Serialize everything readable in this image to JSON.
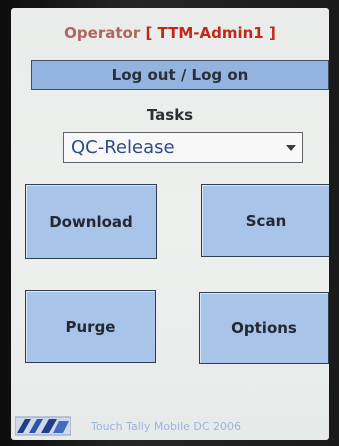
{
  "operator": {
    "label": "Operator",
    "bracket_open": "[",
    "name": "TTM-Admin1",
    "bracket_close": "]"
  },
  "logout_button": {
    "label": "Log out / Log on"
  },
  "tasks": {
    "label": "Tasks",
    "selected": "QC-Release"
  },
  "tiles": {
    "download": "Download",
    "scan": "Scan",
    "purge": "Purge",
    "options": "Options"
  },
  "footer": {
    "logo_icon": "company-logo",
    "text": "Touch Tally Mobile DC 2006"
  },
  "colors": {
    "tile_fill": "#a9c4e9",
    "logout_fill": "#93b4de",
    "operator_name": "#c0281a",
    "select_text": "#2b4b8a",
    "footer_text": "#9bb3df"
  }
}
